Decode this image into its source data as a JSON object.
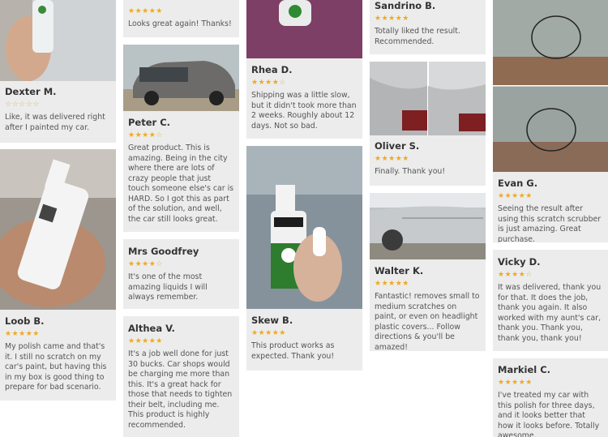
{
  "colors": {
    "card_bg": "#ececec",
    "star": "#f0a920",
    "name": "#333333",
    "text": "#555555"
  },
  "reviews": [
    {
      "name": "Dexter M.",
      "rating": 1,
      "text": "Like, it was delivered right after I painted my car."
    },
    {
      "name": "Loob B.",
      "rating": 5,
      "text": "My polish came and that's it. I still no scratch on my car's paint, but having this in my box is good thing to prepare for bad scenario."
    },
    {
      "name": "",
      "rating": 5,
      "text": "Looks great again! Thanks!"
    },
    {
      "name": "Peter C.",
      "rating": 4,
      "text": "Great product. This is amazing. Being in the city where there are lots of crazy people that just touch someone else's car is HARD. So I got this as part of the solution, and well, the car still looks great."
    },
    {
      "name": "Mrs Goodfrey",
      "rating": 4,
      "text": "It's one of the most amazing liquids I will always remember."
    },
    {
      "name": "Althea V.",
      "rating": 5,
      "text": "It's a job well done for just 30 bucks. Car shops would be charging me more than this. It's a great hack for those that needs to tighten their belt, including me. This product is highly recommended."
    },
    {
      "name": "Rhea D.",
      "rating": 4,
      "text": "Shipping was a little slow, but it didn't took more than 2 weeks. Roughly about 12 days. Not so bad."
    },
    {
      "name": "Skew B.",
      "rating": 5,
      "text": "This product works as expected. Thank you!"
    },
    {
      "name": "Sandrino B.",
      "rating": 5,
      "text": "Totally liked the result. Recommended."
    },
    {
      "name": "Oliver S.",
      "rating": 5,
      "text": "Finally. Thank you!"
    },
    {
      "name": "Walter K.",
      "rating": 5,
      "text": "Fantastic! removes small to medium scratches on paint, or even on headlight plastic covers... Follow directions & you'll be amazed!"
    },
    {
      "name": "Evan G.",
      "rating": 5,
      "text": "Seeing the result after using this scratch scrubber is just amazing. Great purchase."
    },
    {
      "name": "Vicky D.",
      "rating": 4,
      "text": "It was delivered, thank you for that. It does the job, thank you again. It also worked with my aunt's car, thank you. Thank you, thank you, thank you!"
    },
    {
      "name": "Markiel C.",
      "rating": 5,
      "text": "I've treated my car with this polish for three days, and it looks better that how it looks before. Totally awesome."
    }
  ]
}
